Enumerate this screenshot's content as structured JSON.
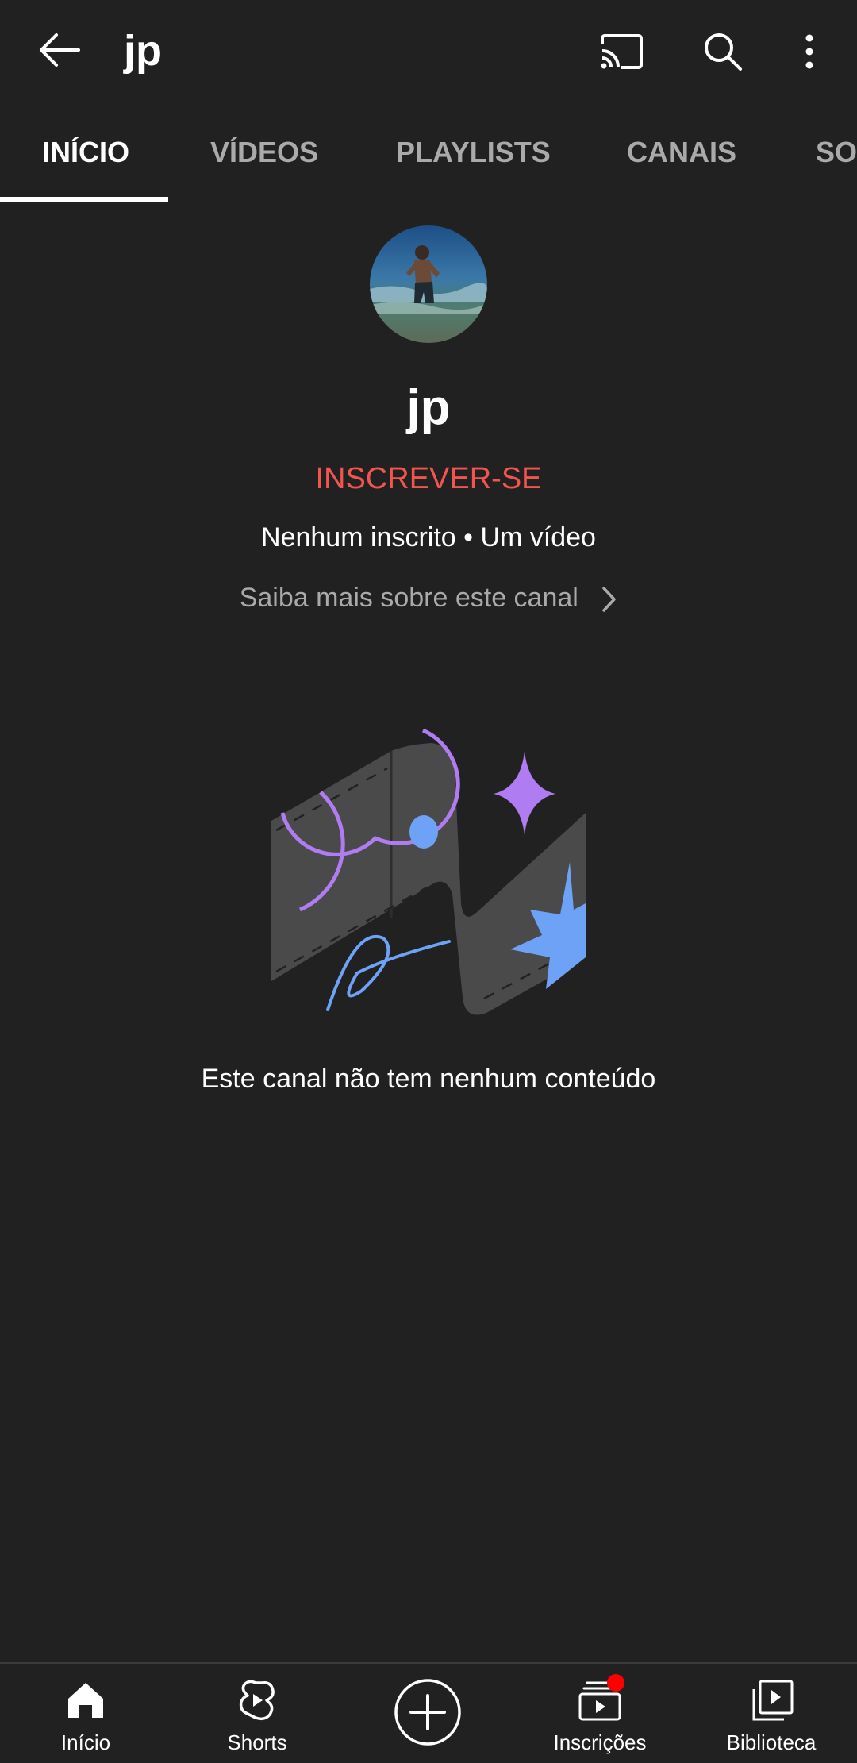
{
  "header": {
    "title": "jp",
    "back_icon": "arrow-left-icon",
    "cast_icon": "cast-icon",
    "search_icon": "search-icon",
    "more_icon": "more-vert-icon"
  },
  "tabs": [
    {
      "label": "INÍCIO",
      "active": true
    },
    {
      "label": "VÍDEOS",
      "active": false
    },
    {
      "label": "PLAYLISTS",
      "active": false
    },
    {
      "label": "CANAIS",
      "active": false
    },
    {
      "label": "SOBRE",
      "active": false
    }
  ],
  "channel": {
    "name": "jp",
    "subscribe_label": "INSCREVER-SE",
    "stats": "Nenhum inscrito • Um vídeo",
    "about_link": "Saiba mais sobre este canal"
  },
  "empty_state": {
    "message": "Este canal não tem nenhum conteúdo"
  },
  "bottom_nav": [
    {
      "label": "Início",
      "icon": "home-icon"
    },
    {
      "label": "Shorts",
      "icon": "shorts-icon"
    },
    {
      "label": "",
      "icon": "create-plus-icon"
    },
    {
      "label": "Inscrições",
      "icon": "subscriptions-icon",
      "badge": true
    },
    {
      "label": "Biblioteca",
      "icon": "library-icon"
    }
  ],
  "colors": {
    "background": "#212121",
    "subscribe": "#f25450",
    "muted_text": "#aaaaaa",
    "badge": "#ff0000",
    "illustration_purple": "#b07cf2",
    "illustration_blue": "#6ea2f7"
  }
}
